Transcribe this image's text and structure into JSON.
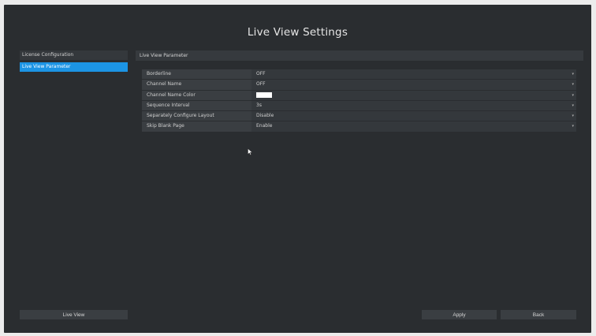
{
  "window": {
    "title": "Live View Settings"
  },
  "sidebar": {
    "items": [
      {
        "label": "License Configuration",
        "active": false
      },
      {
        "label": "Live View Parameter",
        "active": true
      }
    ]
  },
  "main": {
    "section_title": "Live View Parameter",
    "params": [
      {
        "label": "Borderline",
        "value": "OFF"
      },
      {
        "label": "Channel Name",
        "value": "OFF"
      },
      {
        "label": "Channel Name Color",
        "value": "",
        "swatch_color": "#ffffff"
      },
      {
        "label": "Sequence Interval",
        "value": "3s"
      },
      {
        "label": "Separately Configure Layout",
        "value": "Disable"
      },
      {
        "label": "Skip Blank Page",
        "value": "Enable"
      }
    ]
  },
  "footer": {
    "live_view_label": "Live View",
    "apply_label": "Apply",
    "back_label": "Back"
  },
  "colors": {
    "background": "#2a2d30",
    "accent": "#1c94e4",
    "row": "#3a3e42"
  }
}
